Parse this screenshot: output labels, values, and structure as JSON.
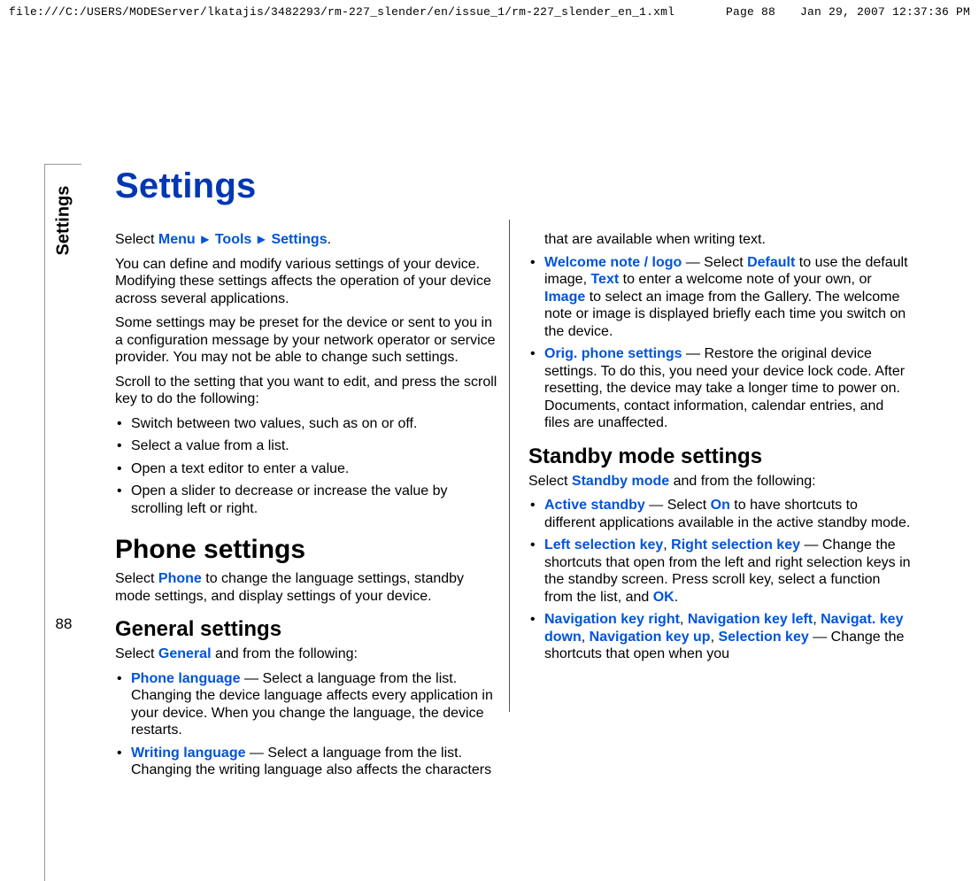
{
  "header": {
    "path": "file:///C:/USERS/MODEServer/lkatajis/3482293/rm-227_slender/en/issue_1/rm-227_slender_en_1.xml",
    "page_label": "Page 88",
    "datetime": "Jan 29, 2007 12:37:36 PM"
  },
  "sidebar": {
    "tab_label": "Settings",
    "page_number": "88"
  },
  "title": "Settings",
  "intro": {
    "select_prefix": "Select ",
    "menu": "Menu",
    "tools": "Tools",
    "settings": "Settings",
    "period": ".",
    "p1": "You can define and modify various settings of your device. Modifying these settings affects the operation of your device across several applications.",
    "p2": "Some settings may be preset for the device or sent to you in a configuration message by your network operator or service provider. You may not be able to change such settings.",
    "p3": "Scroll to the setting that you want to edit, and press the scroll key to do the following:",
    "bullets": [
      "Switch between two values, such as on or off.",
      "Select a value from a list.",
      "Open a text editor to enter a value.",
      "Open a slider to decrease or increase the value by scrolling left or right."
    ]
  },
  "phone": {
    "heading": "Phone settings",
    "select_prefix": "Select ",
    "phone": "Phone",
    "rest": " to change the language settings, standby mode settings, and display settings of your device."
  },
  "general": {
    "heading": "General settings",
    "select_prefix": "Select ",
    "general": "General",
    "rest": " and from the following:",
    "items": {
      "phone_lang": {
        "term": "Phone language",
        "sep": " — ",
        "text": "Select a language from the list. Changing the device language affects every application in your device. When you change the language, the device restarts."
      },
      "writing_lang": {
        "term": "Writing language",
        "sep": " — ",
        "text": "Select a language from the list. Changing the writing language also affects the characters that are available when writing text."
      },
      "welcome": {
        "term": "Welcome note / logo",
        "sep": " — ",
        "pre": "Select ",
        "default": "Default",
        "mid1": " to use the default image, ",
        "text_opt": "Text",
        "mid2": " to enter a welcome note of your own, or ",
        "image": "Image",
        "post": " to select an image from the Gallery. The welcome note or image is displayed briefly each time you switch on the device."
      },
      "orig": {
        "term": "Orig. phone settings",
        "sep": " — ",
        "text": "Restore the original device settings. To do this, you need your device lock code. After resetting, the device may take a longer time to power on. Documents, contact information, calendar entries, and files are unaffected."
      }
    }
  },
  "standby": {
    "heading": "Standby mode settings",
    "select_prefix": "Select ",
    "standby_mode": "Standby mode",
    "rest": " and from the following:",
    "items": {
      "active": {
        "term": "Active standby",
        "sep": " — ",
        "pre": "Select ",
        "on": "On",
        "post": " to have shortcuts to different applications available in the active standby mode."
      },
      "lrkeys": {
        "left": "Left selection key",
        "comma": ", ",
        "right": "Right selection key",
        "sep": " — ",
        "text": "Change the shortcuts that open from the left and right selection keys in the standby screen. Press scroll key, select a function from the list, and ",
        "ok": "OK",
        "period": "."
      },
      "nav": {
        "k1": "Navigation key right",
        "c": ", ",
        "k2": "Navigation key left",
        "k3": "Navigat. key down",
        "k4": "Navigation key up",
        "k5": "Selection key",
        "sep": " — ",
        "text": "Change the shortcuts that open when you"
      }
    }
  }
}
